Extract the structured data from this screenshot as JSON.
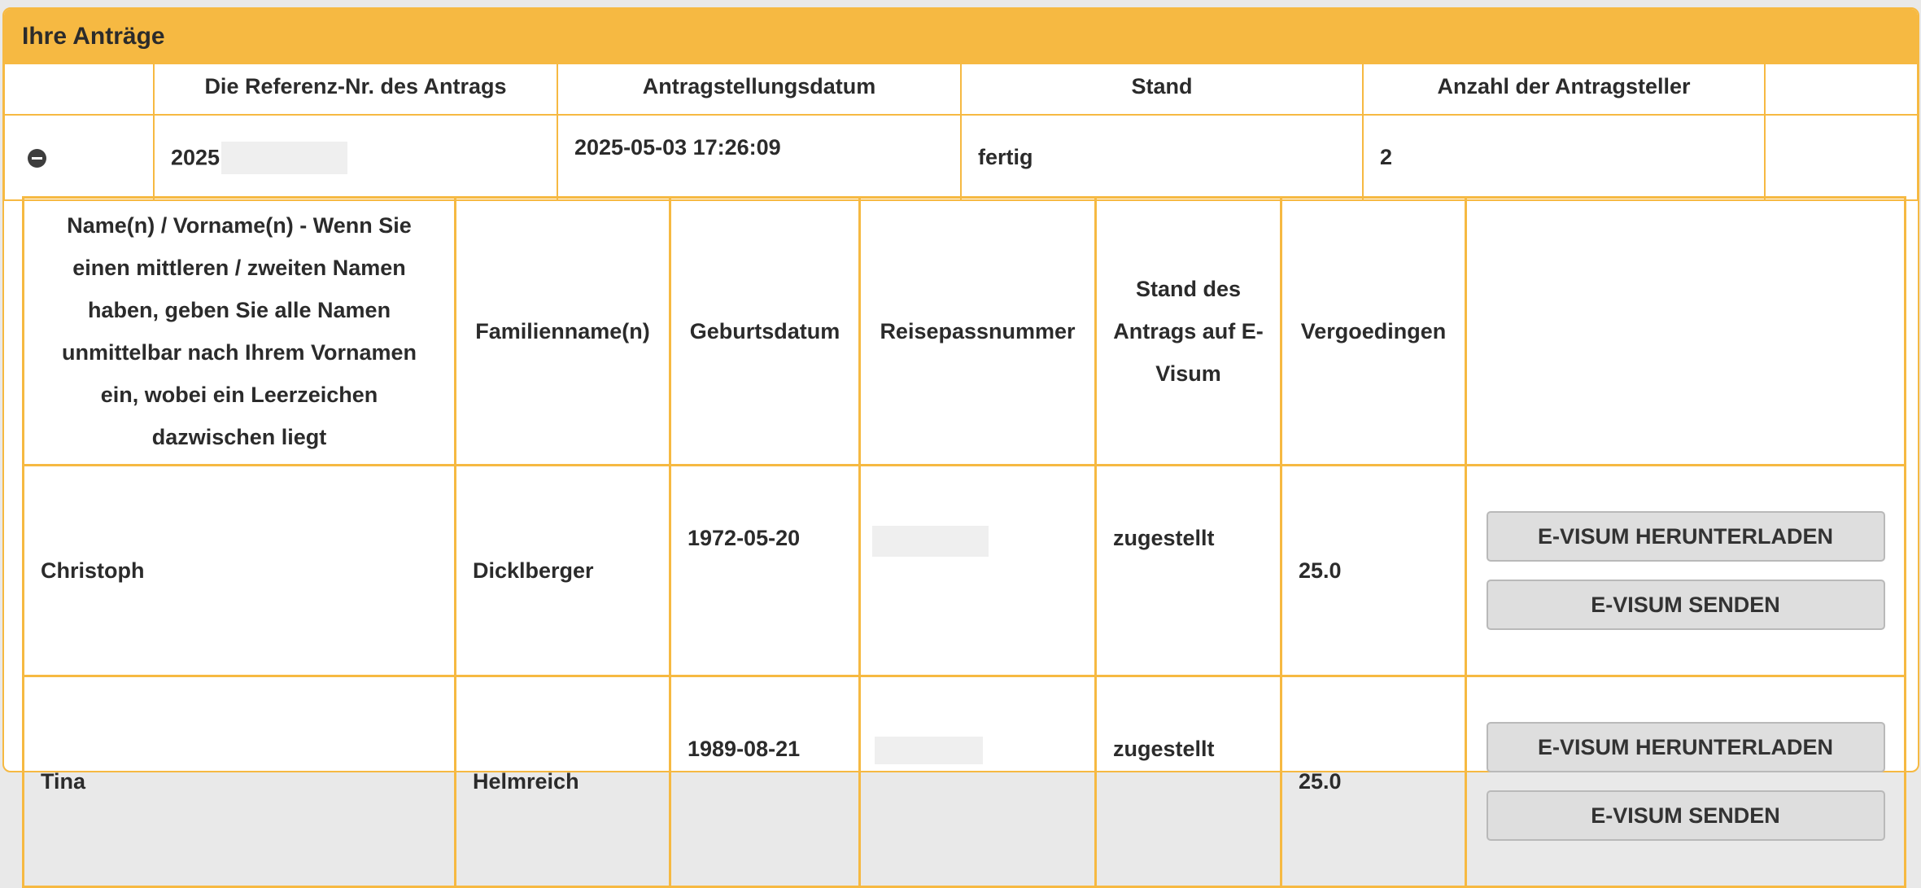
{
  "panel": {
    "title": "Ihre Anträge"
  },
  "applications": {
    "columns": {
      "reference": "Die Referenz-Nr. des Antrags",
      "date": "Antragstellungsdatum",
      "status": "Stand",
      "applicant_count": "Anzahl der Antragsteller"
    },
    "rows": [
      {
        "icon": "collapse-icon",
        "reference_prefix": "2025",
        "date": "2025-05-03 17:26:09",
        "status": "fertig",
        "applicant_count": "2"
      }
    ]
  },
  "applicants": {
    "columns": {
      "first_names": "Name(n) / Vorname(n) - Wenn Sie einen mittleren / zweiten Namen haben, geben Sie alle Namen unmittelbar nach Ihrem Vornamen ein, wobei ein Leerzeichen dazwischen liegt",
      "family_name": "Familienname(n)",
      "birth_date": "Geburtsdatum",
      "passport": "Reisepassnummer",
      "evisa_status": "Stand des Antrags auf E-Visum",
      "fees": "Vergoedingen"
    },
    "rows": [
      {
        "first_names": "Christoph",
        "family_name": "Dicklberger",
        "birth_date": "1972-05-20",
        "evisa_status": "zugestellt",
        "fees": "25.0",
        "download_label": "E-VISUM HERUNTERLADEN",
        "send_label": "E-VISUM SENDEN"
      },
      {
        "first_names": "Tina",
        "family_name": "Helmreich",
        "birth_date": "1989-08-21",
        "evisa_status": "zugestellt",
        "fees": "25.0",
        "download_label": "E-VISUM HERUNTERLADEN",
        "send_label": "E-VISUM SENDEN"
      }
    ]
  },
  "colors": {
    "accent": "#f6b942",
    "button_bg": "#dedede",
    "text": "#2b2b2b"
  }
}
